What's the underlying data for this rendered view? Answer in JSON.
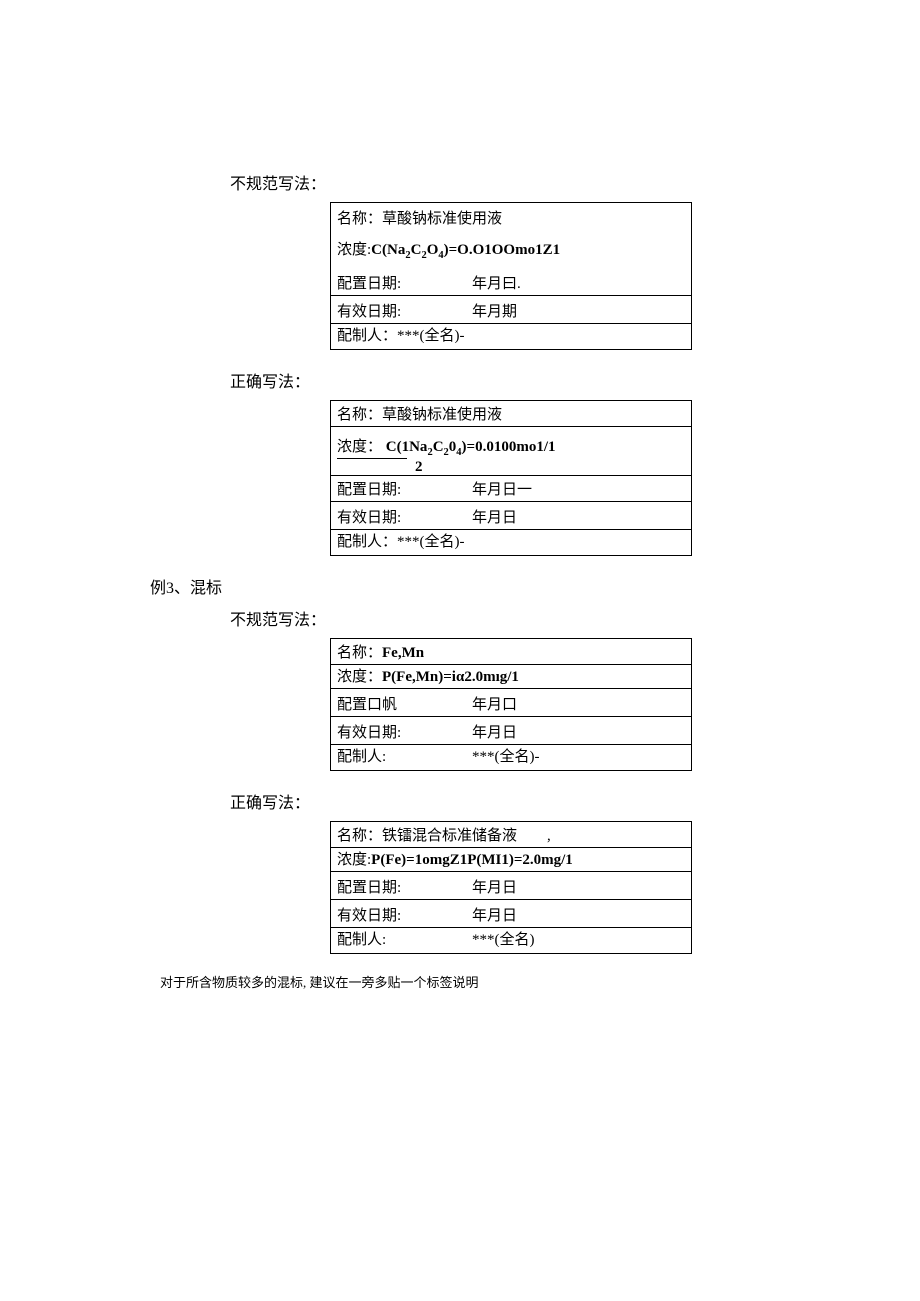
{
  "sec1": {
    "irregular_heading": "不规范写法：",
    "correct_heading": "正确写法：",
    "box1": {
      "name_label": "名称：草酸钠标准使用液",
      "conc_prefix": "浓度:",
      "conc_formula_pre": "C(Na",
      "conc_formula_mid": "C",
      "conc_formula_post": ")=O.O1OOmo1Z1",
      "prepdate_label": "配置日期:",
      "prepdate_value": "年月曰.",
      "expiry_label": "有效日期:",
      "expiry_value": "年月期",
      "preparer": "配制人：***(全名)-"
    },
    "box2": {
      "name_label": "名称：草酸钠标准使用液",
      "conc_prefix": "浓度：",
      "conc_formula_pre": "C(1Na",
      "conc_formula_mid": "C",
      "conc_formula_post": ")=0.0100mo1/1",
      "denominator": "2",
      "prepdate_label": "配置日期:",
      "prepdate_value": "年月日一",
      "expiry_label": "有效日期:",
      "expiry_value": "年月日",
      "preparer": "配制人：***(全名)-"
    }
  },
  "sec2": {
    "example_heading": "例3、混标",
    "irregular_heading": "不规范写法：",
    "correct_heading": "正确写法：",
    "box3": {
      "name_label": "名称：Fe,Mn",
      "conc_label": "浓度：P(Fe,Mn)=iα2.0mıg/1",
      "prepdate_label": "配置口帆",
      "prepdate_value": "年月口",
      "expiry_label": "有效日期:",
      "expiry_value": "年月日",
      "preparer_label": "配制人:",
      "preparer_value": "***(全名)-"
    },
    "box4": {
      "name_label": "名称：铁镭混合标准储备液        ,",
      "conc_label": "浓度:P(Fe)=1omgZ1P(MI1)=2.0mg/1",
      "prepdate_label": "配置日期:",
      "prepdate_value": "年月日",
      "expiry_label": "有效日期:",
      "expiry_value": "年月日",
      "preparer_label": "配制人:",
      "preparer_value": "***(全名)"
    }
  },
  "footer": "对于所含物质较多的混标, 建议在一旁多贴一个标签说明"
}
